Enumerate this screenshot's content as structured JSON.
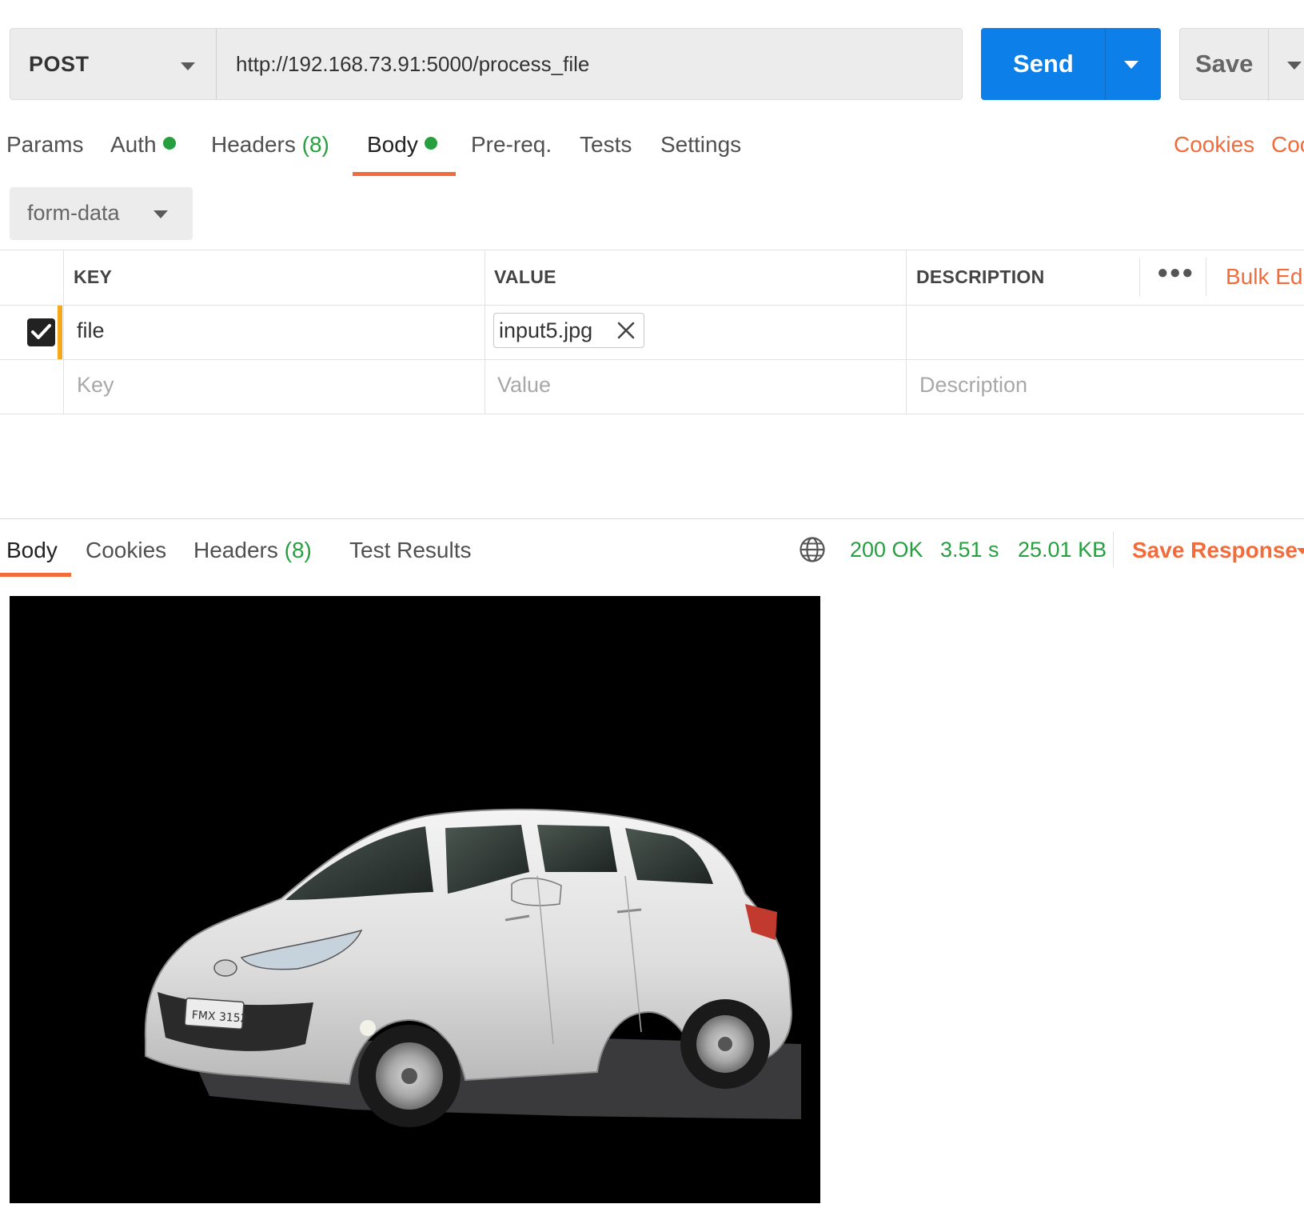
{
  "request": {
    "method": "POST",
    "url": "http://192.168.73.91:5000/process_file",
    "send_label": "Send",
    "save_label": "Save"
  },
  "request_tabs": {
    "params": "Params",
    "auth": "Auth",
    "headers": "Headers",
    "headers_count": "(8)",
    "body": "Body",
    "prereq": "Pre-req.",
    "tests": "Tests",
    "settings": "Settings",
    "active": "Body"
  },
  "links": {
    "cookies": "Cookies",
    "code_partial": "Coc",
    "bulk_edit_partial": "Bulk Edi"
  },
  "body_type": "form-data",
  "params_table": {
    "columns": [
      "KEY",
      "VALUE",
      "DESCRIPTION"
    ],
    "rows": [
      {
        "checked": true,
        "key": "file",
        "value_file": "input5.jpg",
        "description": ""
      }
    ],
    "placeholders": {
      "key": "Key",
      "value": "Value",
      "description": "Description"
    }
  },
  "response": {
    "tabs": {
      "body": "Body",
      "cookies": "Cookies",
      "headers": "Headers",
      "headers_count": "(8)",
      "test_results": "Test Results",
      "active": "Body"
    },
    "status": "200 OK",
    "time": "3.51 s",
    "size": "25.01 KB",
    "save_response": "Save Response",
    "preview_alt": "image preview"
  },
  "colors": {
    "accent": "#f26b3a",
    "send_blue": "#0c7fe8",
    "success_green": "#26a03f",
    "row_marker": "#f6a81a"
  },
  "icons": {
    "method_dropdown": "chevron-down-icon",
    "send_dropdown": "chevron-down-icon",
    "checkbox": "checkmark-icon",
    "remove_file": "close-icon",
    "globe": "globe-icon",
    "more": "ellipsis-icon"
  }
}
